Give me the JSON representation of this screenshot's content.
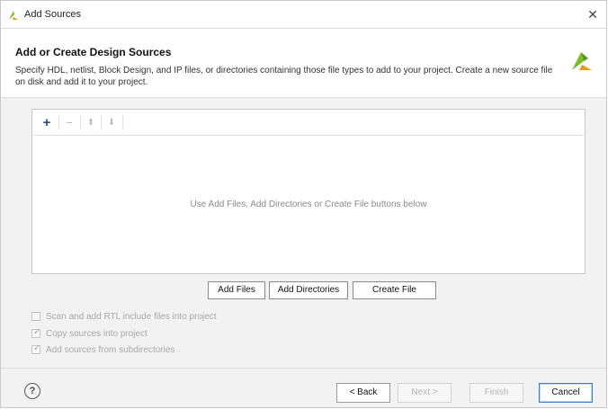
{
  "window": {
    "title": "Add Sources",
    "close_glyph": "✕",
    "accent_color": "#7dbb23"
  },
  "header": {
    "title": "Add or Create Design Sources",
    "description": "Specify HDL, netlist, Block Design, and IP files, or directories containing those file types to add to your project. Create a new source file on disk and add it to your project."
  },
  "toolbar": {
    "add_glyph": "+",
    "remove_glyph": "−",
    "up_glyph": "⬆",
    "down_glyph": "⬇"
  },
  "sources_panel": {
    "empty_message": "Use Add Files, Add Directories or Create File buttons below"
  },
  "action_buttons": {
    "add_files": "Add Files",
    "add_directories": "Add Directories",
    "create_file": "Create File"
  },
  "options": [
    {
      "label": "Scan and add RTL include files into project",
      "checked": false
    },
    {
      "label": "Copy sources into project",
      "checked": true
    },
    {
      "label": "Add sources from subdirectories",
      "checked": true
    }
  ],
  "footer": {
    "help_glyph": "?",
    "back": "< Back",
    "next": "Next >",
    "finish": "Finish",
    "cancel": "Cancel"
  }
}
